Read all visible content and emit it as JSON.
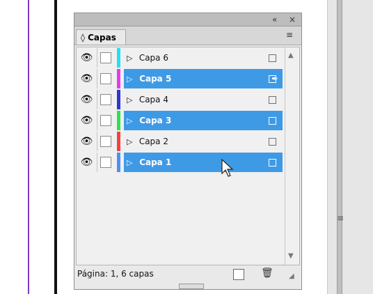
{
  "panel": {
    "tab_label": "◊ Capas",
    "status_text": "Página: 1, 6 capas"
  },
  "layers": [
    {
      "name": "Capa 6",
      "selected": false,
      "color": "#21e0f6",
      "expand_icon": "▷",
      "eye_icon": "eye-icon"
    },
    {
      "name": "Capa 5",
      "selected": true,
      "color": "#e83aed",
      "expand_icon": "▷",
      "eye_icon": "eye-icon",
      "pen_icon": "pen-icon"
    },
    {
      "name": "Capa 4",
      "selected": false,
      "color": "#2e35d3",
      "expand_icon": "▷",
      "eye_icon": "eye-icon"
    },
    {
      "name": "Capa 3",
      "selected": true,
      "color": "#2fe24c",
      "expand_icon": "▷",
      "eye_icon": "eye-icon"
    },
    {
      "name": "Capa 2",
      "selected": false,
      "color": "#f24241",
      "expand_icon": "▷",
      "eye_icon": "eye-icon"
    },
    {
      "name": "Capa 1",
      "selected": true,
      "color": "#4a91f2",
      "expand_icon": "▷",
      "eye_icon": "eye-icon"
    }
  ],
  "icons": {
    "collapse": "«",
    "close": "×",
    "menu": "≡",
    "scroll_up": "▲",
    "scroll_down": "▼",
    "trash": "🗑",
    "resize": "◢",
    "gutter_grip": "≡"
  }
}
